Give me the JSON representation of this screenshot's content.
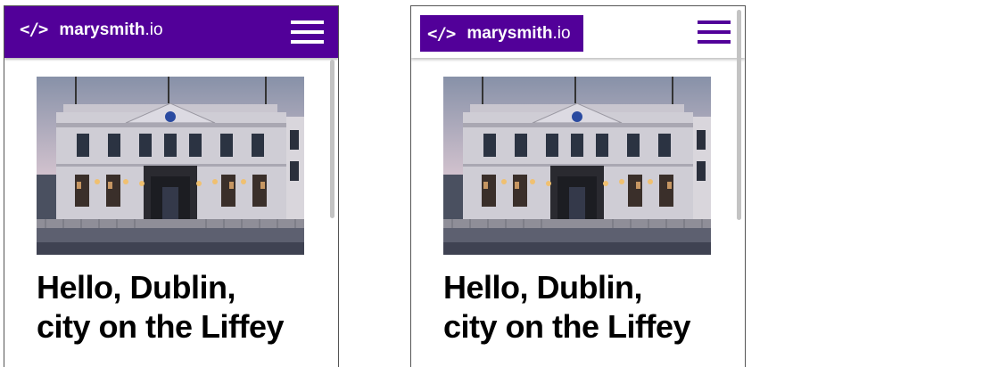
{
  "brand": {
    "code_icon": "</>",
    "name": "marysmith",
    "tld": ".io"
  },
  "article": {
    "headline_line1": "Hello, Dublin,",
    "headline_line2": "city on the Liffey",
    "image_subject": "Mansion House, Dublin"
  },
  "colors": {
    "brand_purple": "#520099",
    "header_alt_bg": "#ffffff",
    "text": "#000000"
  },
  "icons": {
    "code": "code-brackets-icon",
    "menu": "hamburger-menu-icon"
  }
}
